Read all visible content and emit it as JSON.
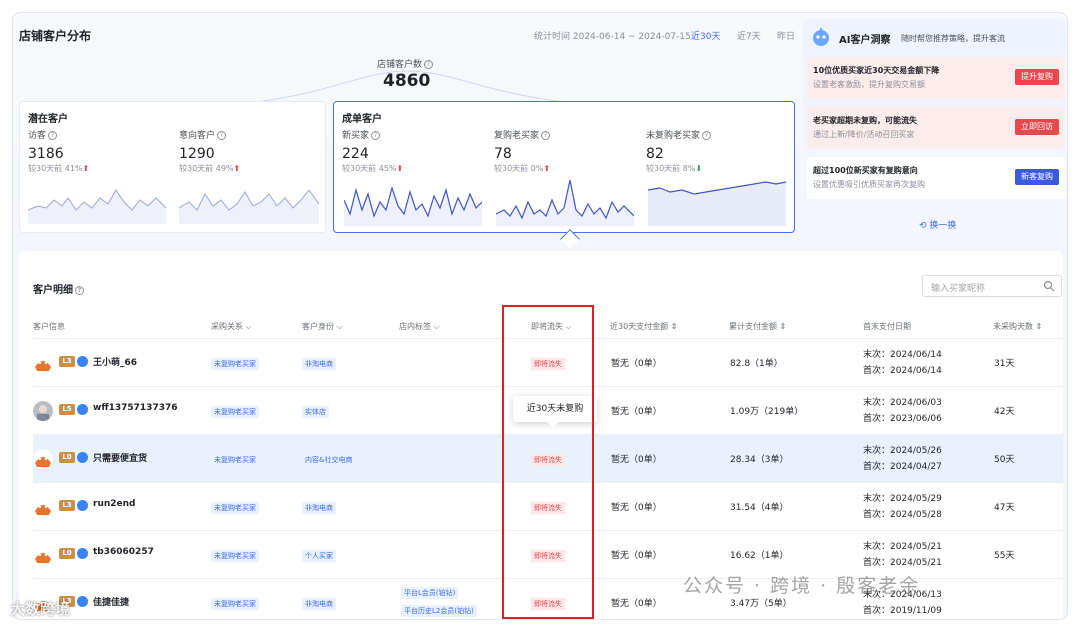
{
  "header": {
    "title": "店铺客户分布",
    "stat_time": "统计时间 2024-06-14 ~ 2024-07-15",
    "range_tabs": [
      "近30天",
      "近7天",
      "昨日"
    ],
    "total_label": "店铺客户数",
    "total_value": "4860"
  },
  "potential": {
    "title": "潜在客户",
    "metrics": [
      {
        "label": "访客",
        "value": "3186",
        "compare": "较30天前",
        "change": "41%",
        "trend": "up"
      },
      {
        "label": "意向客户",
        "value": "1290",
        "compare": "较30天前",
        "change": "49%",
        "trend": "up"
      }
    ]
  },
  "converted": {
    "title": "成单客户",
    "metrics": [
      {
        "label": "新买家",
        "value": "224",
        "compare": "较30天前",
        "change": "45%",
        "trend": "up"
      },
      {
        "label": "复购老买家",
        "value": "78",
        "compare": "较30天前",
        "change": "0%",
        "trend": "up"
      },
      {
        "label": "未复购老买家",
        "value": "82",
        "compare": "较30天前",
        "change": "8%",
        "trend": "down"
      }
    ]
  },
  "ai": {
    "title": "AI客户洞察",
    "subtitle": "随时帮您推荐策略，提升客流",
    "items": [
      {
        "title": "10位优质买家近30天交易金额下降",
        "desc": "设置老客激励，提升复购交易额",
        "button": "提升复购",
        "color": "#e5484d"
      },
      {
        "title": "老买家超期未复购，可能流失",
        "desc": "通过上新/降价/活动召回买家",
        "button": "立即回访",
        "color": "#e5484d"
      },
      {
        "title": "超过100位新买家有复购意向",
        "desc": "设置优惠吸引优质买家再次复购",
        "button": "新客复购",
        "color": "#3b5bdb"
      }
    ],
    "refresh": "换一换"
  },
  "table": {
    "title": "客户明细",
    "search_placeholder": "输入买家昵称",
    "headers": [
      "客户信息",
      "采购关系",
      "客户身份",
      "店内标签",
      "即将流失",
      "近30天支付金额",
      "累计支付金额",
      "首末支付日期",
      "未采购天数"
    ],
    "rows": [
      {
        "level": "L3",
        "level_color": "#c9904a",
        "name": "王小萌_66",
        "relation": "未复购老买家",
        "identity": "非淘电商",
        "store_tags": [],
        "churn": "即将流失",
        "amount_30d": "暂无（0单）",
        "amount_total": "82.8（1单）",
        "last": "末次：2024/06/14",
        "first": "首次：2024/06/14",
        "days": "31天",
        "highlight": false
      },
      {
        "level": "L5",
        "level_color": "#c9904a",
        "name": "wff13757137376",
        "relation": "未复购老买家",
        "identity": "实体店",
        "store_tags": [],
        "churn": "即将流失",
        "amount_30d": "暂无（0单）",
        "amount_total": "1.09万（219单）",
        "last": "末次：2024/06/03",
        "first": "首次：2023/06/06",
        "days": "42天",
        "highlight": false
      },
      {
        "level": "L0",
        "level_color": "#c9904a",
        "name": "只需要便宜货",
        "relation": "未复购老买家",
        "identity": "内容&社交电商",
        "store_tags": [],
        "churn": "即将流失",
        "amount_30d": "暂无（0单）",
        "amount_total": "28.34（3单）",
        "last": "末次：2024/05/26",
        "first": "首次：2024/04/27",
        "days": "50天",
        "highlight": true
      },
      {
        "level": "L3",
        "level_color": "#c9904a",
        "name": "run2end",
        "relation": "未复购老买家",
        "identity": "非淘电商",
        "store_tags": [],
        "churn": "即将流失",
        "amount_30d": "暂无（0单）",
        "amount_total": "31.54（4单）",
        "last": "末次：2024/05/29",
        "first": "首次：2024/05/28",
        "days": "47天",
        "highlight": false
      },
      {
        "level": "L0",
        "level_color": "#c9904a",
        "name": "tb36060257",
        "relation": "未复购老买家",
        "identity": "个人买家",
        "store_tags": [],
        "churn": "即将流失",
        "amount_30d": "暂无（0单）",
        "amount_total": "16.62（1单）",
        "last": "末次：2024/05/21",
        "first": "首次：2024/05/21",
        "days": "55天",
        "highlight": false
      },
      {
        "level": "L3",
        "level_color": "#c9904a",
        "name": "佳捷佳捷",
        "relation": "未复购老买家",
        "identity": "非淘电商",
        "store_tags": [
          "平台L会员(铂钻)",
          "平台历史L2会员(铂钻)"
        ],
        "churn": "即将流失",
        "amount_30d": "暂无（0单）",
        "amount_total": "3.47万（5单）",
        "last": "末次：2024/06/13",
        "first": "首次：2019/11/09",
        "days": "",
        "highlight": false
      }
    ],
    "tooltip": "近30天未复购"
  },
  "watermarks": {
    "right": "公众号 · 跨境 · 殷客老余",
    "left": "大数跨境"
  }
}
